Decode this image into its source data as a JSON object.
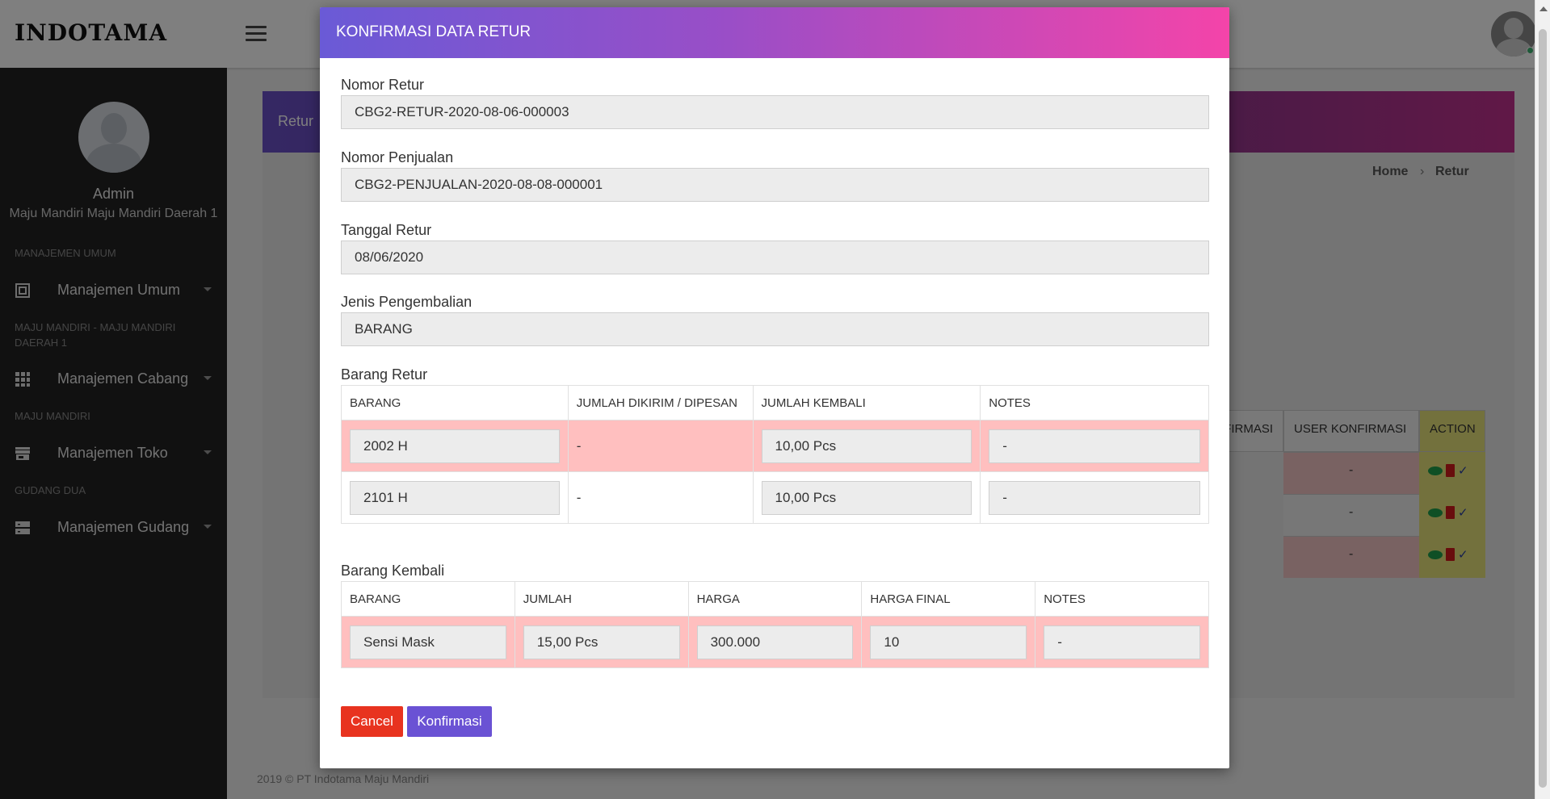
{
  "app": {
    "brand": "INDOTAMA",
    "footer": "2019 © PT Indotama Maju Mandiri"
  },
  "sidebar": {
    "user_name": "Admin",
    "user_company": "Maju Mandiri Maju Mandiri Daerah 1",
    "sections": [
      {
        "title": "MANAJEMEN UMUM",
        "item": "Manajemen Umum",
        "icon": "building-icon"
      },
      {
        "title": "MAJU MANDIRI - MAJU MANDIRI DAERAH 1",
        "item": "Manajemen Cabang",
        "icon": "grid-icon"
      },
      {
        "title": "MAJU MANDIRI",
        "item": "Manajemen Toko",
        "icon": "store-icon"
      },
      {
        "title": "GUDANG DUA",
        "item": "Manajemen Gudang",
        "icon": "server-icon"
      }
    ]
  },
  "page": {
    "header_title": "Retur",
    "breadcrumb": {
      "home": "Home",
      "separator": "›",
      "current": "Retur"
    },
    "table_partial_headers": [
      "FIRMASI",
      "USER KONFIRMASI",
      "ACTION"
    ],
    "row_user_values": [
      "-",
      "-",
      "-"
    ]
  },
  "modal": {
    "title": "KONFIRMASI DATA RETUR",
    "fields": {
      "nomor_retur": {
        "label": "Nomor Retur",
        "value": "CBG2-RETUR-2020-08-06-000003"
      },
      "nomor_penjualan": {
        "label": "Nomor Penjualan",
        "value": "CBG2-PENJUALAN-2020-08-08-000001"
      },
      "tanggal_retur": {
        "label": "Tanggal Retur",
        "value": "08/06/2020"
      },
      "jenis_pengembalian": {
        "label": "Jenis Pengembalian",
        "value": "BARANG"
      }
    },
    "barang_retur": {
      "label": "Barang Retur",
      "headers": [
        "BARANG",
        "JUMLAH DIKIRIM / DIPESAN",
        "JUMLAH KEMBALI",
        "NOTES"
      ],
      "rows": [
        {
          "barang": "2002 H",
          "jumlah_dikirim": "-",
          "jumlah_kembali": "10,00 Pcs",
          "notes": "-"
        },
        {
          "barang": "2101 H",
          "jumlah_dikirim": "-",
          "jumlah_kembali": "10,00 Pcs",
          "notes": "-"
        }
      ]
    },
    "barang_kembali": {
      "label": "Barang Kembali",
      "headers": [
        "BARANG",
        "JUMLAH",
        "HARGA",
        "HARGA FINAL",
        "NOTES"
      ],
      "rows": [
        {
          "barang": "Sensi Mask",
          "jumlah": "15,00 Pcs",
          "harga": "300.000",
          "harga_final": "10",
          "notes": "-"
        }
      ]
    },
    "buttons": {
      "cancel": "Cancel",
      "confirm": "Konfirmasi"
    }
  }
}
